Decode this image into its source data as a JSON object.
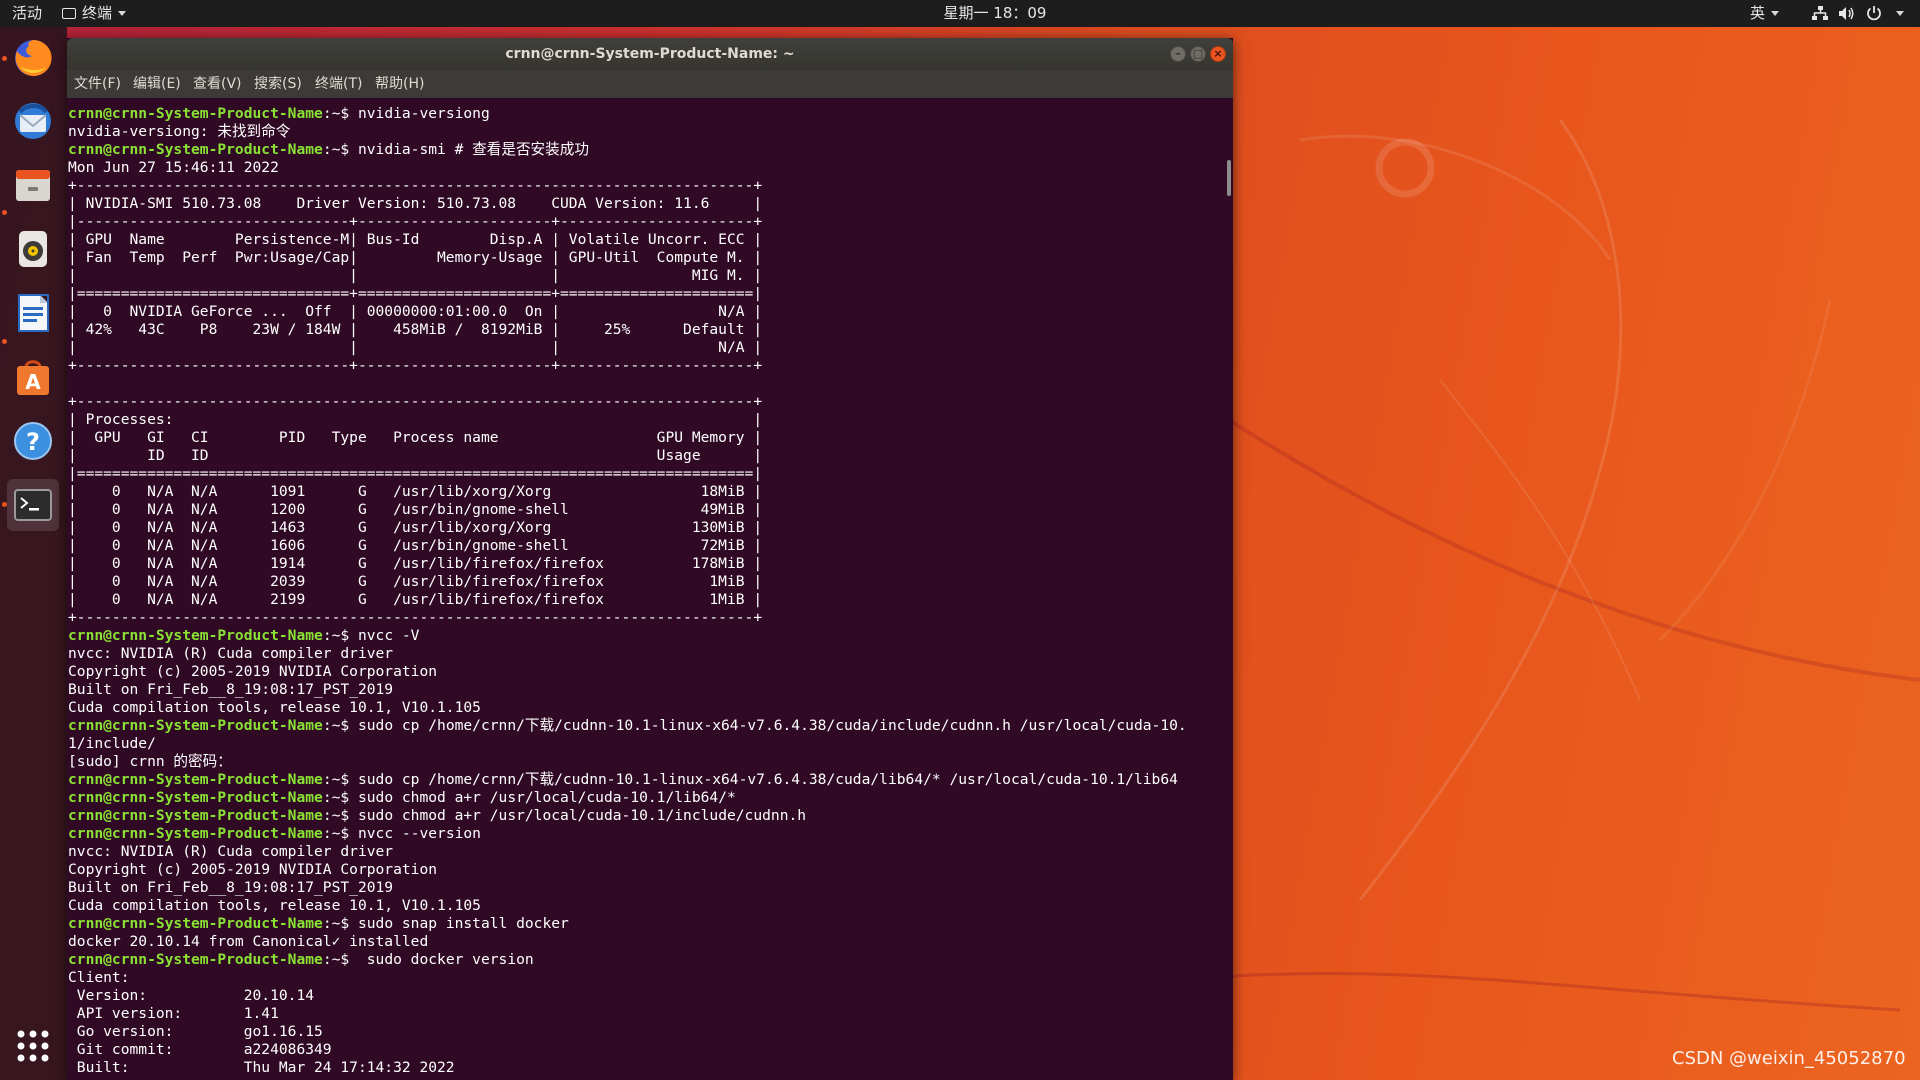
{
  "topbar": {
    "activities": "活动",
    "app_menu": "终端",
    "clock": "星期一 18：09",
    "input_method": "英"
  },
  "dock": {
    "apps": [
      {
        "name": "firefox-icon",
        "running": true
      },
      {
        "name": "thunderbird-icon",
        "running": false
      },
      {
        "name": "files-icon",
        "running": true
      },
      {
        "name": "rhythmbox-icon",
        "running": false
      },
      {
        "name": "libreoffice-writer-icon",
        "running": true
      },
      {
        "name": "software-center-icon",
        "running": false
      },
      {
        "name": "help-icon",
        "running": false
      },
      {
        "name": "terminal-icon",
        "running": true
      }
    ],
    "show_apps": "grid-icon"
  },
  "window": {
    "title": "crnn@crnn-System-Product-Name: ~",
    "menu": [
      "文件(F)",
      "编辑(E)",
      "查看(V)",
      "搜索(S)",
      "终端(T)",
      "帮助(H)"
    ]
  },
  "terminal": {
    "prompt": "crnn@crnn-System-Product-Name",
    "lines": [
      {
        "p": true,
        "t": ":~$ nvidia-versiong"
      },
      {
        "p": false,
        "t": "nvidia-versiong: 未找到命令"
      },
      {
        "p": true,
        "t": ":~$ nvidia-smi # 查看是否安装成功"
      },
      {
        "p": false,
        "t": "Mon Jun 27 15:46:11 2022"
      },
      {
        "p": false,
        "t": "+-----------------------------------------------------------------------------+"
      },
      {
        "p": false,
        "t": "| NVIDIA-SMI 510.73.08    Driver Version: 510.73.08    CUDA Version: 11.6     |"
      },
      {
        "p": false,
        "t": "|-------------------------------+----------------------+----------------------+"
      },
      {
        "p": false,
        "t": "| GPU  Name        Persistence-M| Bus-Id        Disp.A | Volatile Uncorr. ECC |"
      },
      {
        "p": false,
        "t": "| Fan  Temp  Perf  Pwr:Usage/Cap|         Memory-Usage | GPU-Util  Compute M. |"
      },
      {
        "p": false,
        "t": "|                               |                      |               MIG M. |"
      },
      {
        "p": false,
        "t": "|===============================+======================+======================|"
      },
      {
        "p": false,
        "t": "|   0  NVIDIA GeForce ...  Off  | 00000000:01:00.0  On |                  N/A |"
      },
      {
        "p": false,
        "t": "| 42%   43C    P8    23W / 184W |    458MiB /  8192MiB |     25%      Default |"
      },
      {
        "p": false,
        "t": "|                               |                      |                  N/A |"
      },
      {
        "p": false,
        "t": "+-------------------------------+----------------------+----------------------+"
      },
      {
        "p": false,
        "t": ""
      },
      {
        "p": false,
        "t": "+-----------------------------------------------------------------------------+"
      },
      {
        "p": false,
        "t": "| Processes:                                                                  |"
      },
      {
        "p": false,
        "t": "|  GPU   GI   CI        PID   Type   Process name                  GPU Memory |"
      },
      {
        "p": false,
        "t": "|        ID   ID                                                   Usage      |"
      },
      {
        "p": false,
        "t": "|=============================================================================|"
      },
      {
        "p": false,
        "t": "|    0   N/A  N/A      1091      G   /usr/lib/xorg/Xorg                 18MiB |"
      },
      {
        "p": false,
        "t": "|    0   N/A  N/A      1200      G   /usr/bin/gnome-shell               49MiB |"
      },
      {
        "p": false,
        "t": "|    0   N/A  N/A      1463      G   /usr/lib/xorg/Xorg                130MiB |"
      },
      {
        "p": false,
        "t": "|    0   N/A  N/A      1606      G   /usr/bin/gnome-shell               72MiB |"
      },
      {
        "p": false,
        "t": "|    0   N/A  N/A      1914      G   /usr/lib/firefox/firefox          178MiB |"
      },
      {
        "p": false,
        "t": "|    0   N/A  N/A      2039      G   /usr/lib/firefox/firefox            1MiB |"
      },
      {
        "p": false,
        "t": "|    0   N/A  N/A      2199      G   /usr/lib/firefox/firefox            1MiB |"
      },
      {
        "p": false,
        "t": "+-----------------------------------------------------------------------------+"
      },
      {
        "p": true,
        "t": ":~$ nvcc -V"
      },
      {
        "p": false,
        "t": "nvcc: NVIDIA (R) Cuda compiler driver"
      },
      {
        "p": false,
        "t": "Copyright (c) 2005-2019 NVIDIA Corporation"
      },
      {
        "p": false,
        "t": "Built on Fri_Feb__8_19:08:17_PST_2019"
      },
      {
        "p": false,
        "t": "Cuda compilation tools, release 10.1, V10.1.105"
      },
      {
        "p": true,
        "t": ":~$ sudo cp /home/crnn/下载/cudnn-10.1-linux-x64-v7.6.4.38/cuda/include/cudnn.h /usr/local/cuda-10."
      },
      {
        "p": false,
        "t": "1/include/"
      },
      {
        "p": false,
        "t": "[sudo] crnn 的密码："
      },
      {
        "p": true,
        "t": ":~$ sudo cp /home/crnn/下载/cudnn-10.1-linux-x64-v7.6.4.38/cuda/lib64/* /usr/local/cuda-10.1/lib64"
      },
      {
        "p": true,
        "t": ":~$ sudo chmod a+r /usr/local/cuda-10.1/lib64/*"
      },
      {
        "p": true,
        "t": ":~$ sudo chmod a+r /usr/local/cuda-10.1/include/cudnn.h"
      },
      {
        "p": true,
        "t": ":~$ nvcc --version"
      },
      {
        "p": false,
        "t": "nvcc: NVIDIA (R) Cuda compiler driver"
      },
      {
        "p": false,
        "t": "Copyright (c) 2005-2019 NVIDIA Corporation"
      },
      {
        "p": false,
        "t": "Built on Fri_Feb__8_19:08:17_PST_2019"
      },
      {
        "p": false,
        "t": "Cuda compilation tools, release 10.1, V10.1.105"
      },
      {
        "p": true,
        "t": ":~$ sudo snap install docker"
      },
      {
        "p": false,
        "t": "docker 20.10.14 from Canonical✓ installed"
      },
      {
        "p": true,
        "t": ":~$  sudo docker version"
      },
      {
        "p": false,
        "t": "Client:"
      },
      {
        "p": false,
        "t": " Version:           20.10.14"
      },
      {
        "p": false,
        "t": " API version:       1.41"
      },
      {
        "p": false,
        "t": " Go version:        go1.16.15"
      },
      {
        "p": false,
        "t": " Git commit:        a224086349"
      },
      {
        "p": false,
        "t": " Built:             Thu Mar 24 17:14:32 2022"
      }
    ]
  },
  "watermark": "CSDN @weixin_45052870",
  "colors": {
    "terminal_bg": "#300a24",
    "prompt_green": "#8ae234",
    "ubuntu_orange": "#e95420"
  }
}
